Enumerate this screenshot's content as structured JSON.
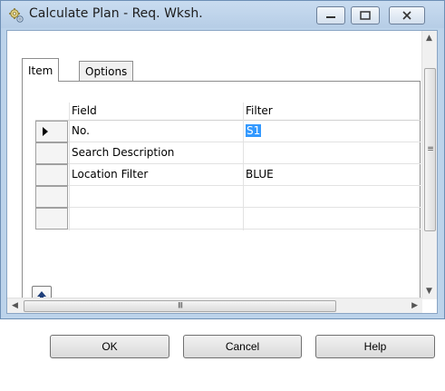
{
  "window": {
    "title": "Calculate Plan - Req. Wksh.",
    "icon": "gears-icon"
  },
  "tabs": [
    {
      "label": "Item",
      "active": true
    },
    {
      "label": "Options",
      "active": false
    }
  ],
  "grid": {
    "columns": [
      "Field",
      "Filter"
    ],
    "rows": [
      {
        "field": "No.",
        "filter": "S1",
        "current": true
      },
      {
        "field": "Search Description",
        "filter": "",
        "current": false
      },
      {
        "field": "Location Filter",
        "filter": "BLUE",
        "current": false
      },
      {
        "field": "",
        "filter": "",
        "current": false
      },
      {
        "field": "",
        "filter": "",
        "current": false
      }
    ]
  },
  "buttons": {
    "ok": "OK",
    "cancel": "Cancel",
    "help": "Help"
  },
  "colors": {
    "selection": "#3399ff",
    "frame": "#bcd3ea"
  }
}
